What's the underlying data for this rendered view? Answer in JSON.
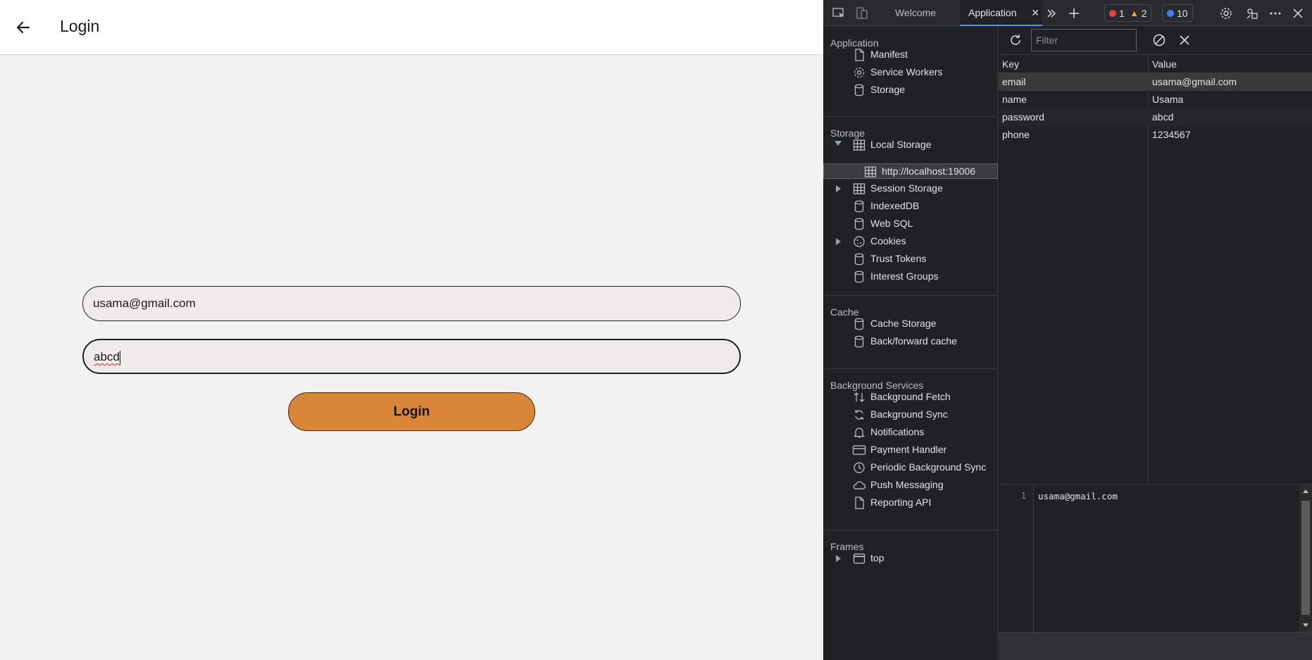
{
  "app": {
    "title": "Login",
    "email_value": "usama@gmail.com",
    "password_value": "abcd",
    "login_label": "Login",
    "accent_color": "#d98638"
  },
  "devtools": {
    "tabs": {
      "welcome": "Welcome",
      "application": "Application",
      "close": "✕"
    },
    "counters": {
      "errors": "1",
      "warnings": "2",
      "messages": "10"
    },
    "filter_placeholder": "Filter",
    "sidebar": {
      "sections": {
        "application": "Application",
        "storage": "Storage",
        "cache": "Cache",
        "background": "Background Services",
        "frames": "Frames"
      },
      "application_items": [
        "Manifest",
        "Service Workers",
        "Storage"
      ],
      "storage_items": {
        "local_storage": "Local Storage",
        "local_origin": "http://localhost:19006",
        "session_storage": "Session Storage",
        "indexeddb": "IndexedDB",
        "websql": "Web SQL",
        "cookies": "Cookies",
        "trust_tokens": "Trust Tokens",
        "interest_groups": "Interest Groups"
      },
      "cache_items": [
        "Cache Storage",
        "Back/forward cache"
      ],
      "background_items": [
        "Background Fetch",
        "Background Sync",
        "Notifications",
        "Payment Handler",
        "Periodic Background Sync",
        "Push Messaging",
        "Reporting API"
      ],
      "frames_items": [
        "top"
      ]
    },
    "table": {
      "headers": {
        "key": "Key",
        "value": "Value"
      },
      "rows": [
        {
          "key": "email",
          "value": "usama@gmail.com"
        },
        {
          "key": "name",
          "value": "Usama"
        },
        {
          "key": "password",
          "value": "abcd"
        },
        {
          "key": "phone",
          "value": "1234567"
        }
      ]
    },
    "preview": {
      "line_number": "1",
      "text": "usama@gmail.com"
    }
  }
}
